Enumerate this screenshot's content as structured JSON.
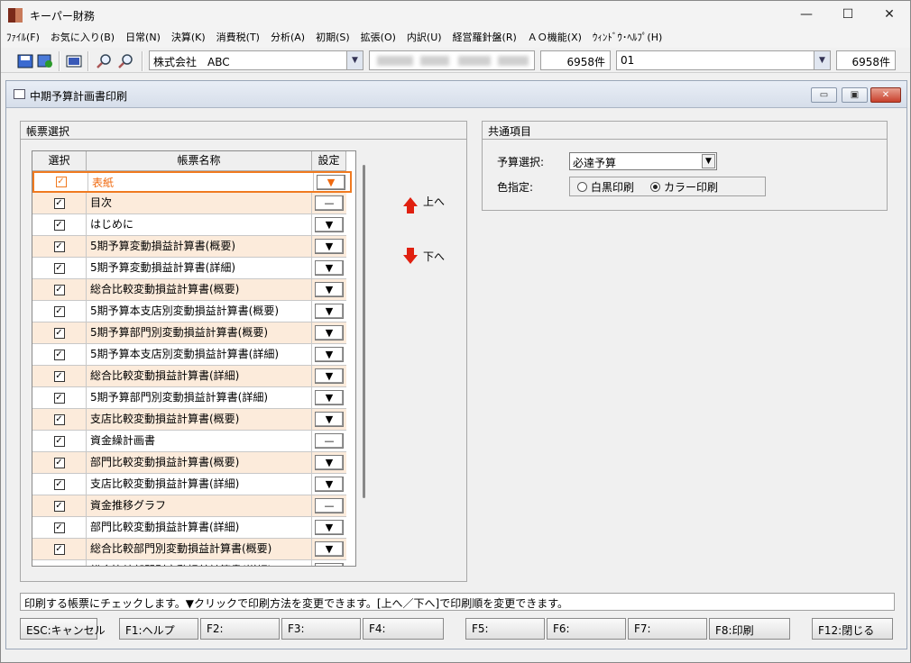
{
  "app": {
    "title": "キーパー財務",
    "brand_colors": [
      "#7a2a1a",
      "#c87a5a"
    ]
  },
  "window_controls": {
    "minimize": "—",
    "maximize": "☐",
    "close": "✕"
  },
  "menu": [
    "ﾌｧｲﾙ(F)",
    "お気に入り(B)",
    "日常(N)",
    "決算(K)",
    "消費税(T)",
    "分析(A)",
    "初期(S)",
    "拡張(O)",
    "内訳(U)",
    "経営羅針盤(R)",
    "ＡＯ機能(X)",
    "ｳｨﾝﾄﾞｳ･ﾍﾙﾌﾟ(H)"
  ],
  "toolbar": {
    "company": "株式会社　ABC",
    "count1": "6958件",
    "code": "01",
    "count2": "6958件",
    "icons": [
      "save-icon",
      "transfer-icon",
      "image-icon",
      "zoom-in-icon",
      "zoom-out-icon"
    ]
  },
  "dialog": {
    "title": "中期予算計画書印刷",
    "buttons": {
      "minimize": "▭",
      "restore": "▣",
      "close": "✕"
    }
  },
  "report_select": {
    "title": "帳票選択",
    "headers": {
      "select": "選択",
      "name": "帳票名称",
      "setting": "設定"
    },
    "rows": [
      {
        "name": "表紙",
        "checked": true,
        "setting": "▼",
        "selected": true
      },
      {
        "name": "目次",
        "checked": true,
        "setting": "—"
      },
      {
        "name": "はじめに",
        "checked": true,
        "setting": "▼"
      },
      {
        "name": "5期予算変動損益計算書(概要)",
        "checked": true,
        "setting": "▼"
      },
      {
        "name": "5期予算変動損益計算書(詳細)",
        "checked": true,
        "setting": "▼"
      },
      {
        "name": "総合比較変動損益計算書(概要)",
        "checked": true,
        "setting": "▼"
      },
      {
        "name": "5期予算本支店別変動損益計算書(概要)",
        "checked": true,
        "setting": "▼"
      },
      {
        "name": "5期予算部門別変動損益計算書(概要)",
        "checked": true,
        "setting": "▼"
      },
      {
        "name": "5期予算本支店別変動損益計算書(詳細)",
        "checked": true,
        "setting": "▼"
      },
      {
        "name": "総合比較変動損益計算書(詳細)",
        "checked": true,
        "setting": "▼"
      },
      {
        "name": "5期予算部門別変動損益計算書(詳細)",
        "checked": true,
        "setting": "▼"
      },
      {
        "name": "支店比較変動損益計算書(概要)",
        "checked": true,
        "setting": "▼"
      },
      {
        "name": "資金繰計画書",
        "checked": true,
        "setting": "—"
      },
      {
        "name": "部門比較変動損益計算書(概要)",
        "checked": true,
        "setting": "▼"
      },
      {
        "name": "支店比較変動損益計算書(詳細)",
        "checked": true,
        "setting": "▼"
      },
      {
        "name": "資金推移グラフ",
        "checked": true,
        "setting": "—"
      },
      {
        "name": "部門比較変動損益計算書(詳細)",
        "checked": true,
        "setting": "▼"
      },
      {
        "name": "総合比較部門別変動損益計算書(概要)",
        "checked": true,
        "setting": "▼"
      },
      {
        "name": "総合比較部門別変動損益計算書(詳細)",
        "checked": true,
        "setting": "▼"
      }
    ],
    "move_up": "上へ",
    "move_down": "下へ"
  },
  "common": {
    "title": "共通項目",
    "budget_label": "予算選択:",
    "budget_value": "必達予算",
    "color_label": "色指定:",
    "color_options": [
      "白黒印刷",
      "カラー印刷"
    ],
    "color_selected": 1
  },
  "status_text": "印刷する帳票にチェックします。▼クリックで印刷方法を変更できます。[上へ／下へ]で印刷順を変更できます。",
  "fkeys": [
    {
      "label": "ESC:キャンセル"
    },
    {
      "label": "F1:ヘルプ"
    },
    {
      "label": "F2:"
    },
    {
      "label": "F3:"
    },
    {
      "label": "F4:"
    },
    {
      "label": "F5:"
    },
    {
      "label": "F6:"
    },
    {
      "label": "F7:"
    },
    {
      "label": "F8:印刷"
    },
    {
      "label": "F12:閉じる"
    }
  ]
}
